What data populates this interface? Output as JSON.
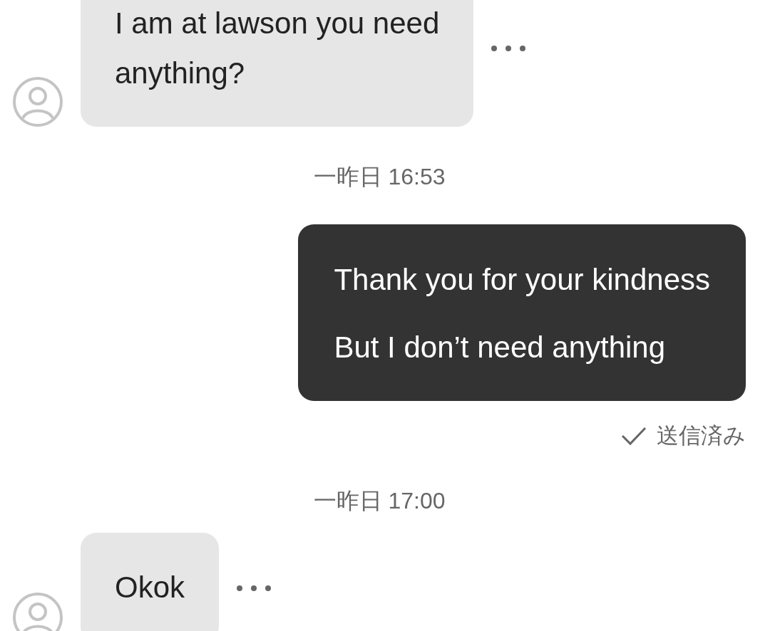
{
  "messages": [
    {
      "kind": "received",
      "lines": [
        "I am at lawson you need",
        "anything?"
      ]
    },
    {
      "kind": "timestamp",
      "text": "一昨日 16:53"
    },
    {
      "kind": "sent",
      "lines": [
        "Thank you for your kindness",
        "But I don’t need anything"
      ],
      "status": "送信済み"
    },
    {
      "kind": "timestamp",
      "text": "一昨日 17:00"
    },
    {
      "kind": "received",
      "lines": [
        "Okok"
      ]
    }
  ]
}
